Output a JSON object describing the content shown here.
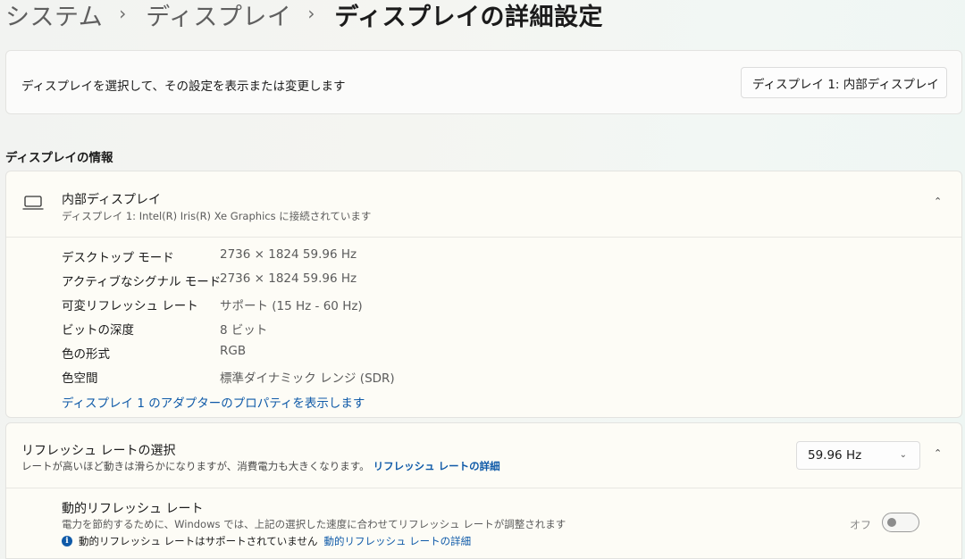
{
  "breadcrumb": {
    "items": [
      "システム",
      "ディスプレイ"
    ],
    "current": "ディスプレイの詳細設定",
    "separator": "›"
  },
  "display_select": {
    "description": "ディスプレイを選択して、その設定を表示または変更します",
    "selected": "ディスプレイ 1: 内部ディスプレイ"
  },
  "display_info": {
    "section_title": "ディスプレイの情報",
    "name": "内部ディスプレイ",
    "subtitle": "ディスプレイ 1: Intel(R) Iris(R) Xe Graphics に接続されています",
    "properties": [
      {
        "label": "デスクトップ モード",
        "value": "2736 × 1824 59.96 Hz"
      },
      {
        "label": "アクティブなシグナル モード",
        "value": "2736 × 1824 59.96 Hz"
      },
      {
        "label": "可変リフレッシュ レート",
        "value": "サポート (15 Hz - 60 Hz)"
      },
      {
        "label": "ビットの深度",
        "value": "8 ビット"
      },
      {
        "label": "色の形式",
        "value": "RGB"
      },
      {
        "label": "色空間",
        "value": "標準ダイナミック レンジ (SDR)"
      }
    ],
    "adapter_link": "ディスプレイ 1 のアダプターのプロパティを表示します"
  },
  "refresh_rate": {
    "title": "リフレッシュ レートの選択",
    "subtitle": "レートが高いほど動きは滑らかになりますが、消費電力も大きくなります。",
    "details_link": "リフレッシュ レートの詳細",
    "selected": "59.96 Hz"
  },
  "dynamic_refresh": {
    "title": "動的リフレッシュ レート",
    "subtitle": "電力を節約するために、Windows では、上記の選択した速度に合わせてリフレッシュ レートが調整されます",
    "note": "動的リフレッシュ レートはサポートされていません",
    "note_link": "動的リフレッシュ レートの詳細",
    "toggle_label": "オフ",
    "toggle_on": false
  },
  "icons": {
    "dropdown": "chevron-down-icon",
    "collapse": "chevron-up-icon",
    "display": "laptop-icon",
    "info": "info-icon"
  },
  "colors": {
    "link": "#0f5aa8",
    "info_badge": "#0f5aa8"
  }
}
